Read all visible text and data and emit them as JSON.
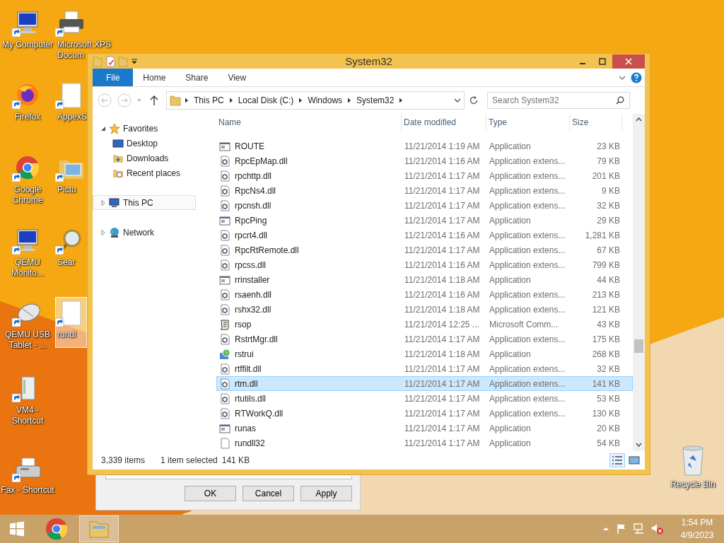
{
  "desktop": {
    "left_column": [
      {
        "label": "My Computer",
        "kind": "monitor",
        "selected": false
      },
      {
        "label": "Firefox",
        "kind": "firefox",
        "selected": false
      },
      {
        "label": "Google Chrome",
        "kind": "chrome",
        "selected": false
      },
      {
        "label": "QEMU Monito...",
        "kind": "monitor",
        "selected": false
      },
      {
        "label": "QEMU USB Tablet - ...",
        "kind": "mouse",
        "selected": false
      },
      {
        "label": "VM4 - Shortcut",
        "kind": "tower",
        "selected": false
      },
      {
        "label": "Fax - Shortcut",
        "kind": "fax",
        "selected": false
      }
    ],
    "second_column": [
      {
        "label_lines": [
          "Microsoft XPS",
          "Docum"
        ],
        "kind": "printer",
        "selected": false
      },
      {
        "label_lines": [
          "AppexS"
        ],
        "kind": "document",
        "selected": false
      },
      {
        "label_lines": [
          "Pictu"
        ],
        "kind": "folder",
        "selected": false
      },
      {
        "label_lines": [
          "Sear"
        ],
        "kind": "magnifier",
        "selected": false
      },
      {
        "label_lines": [
          "rundl"
        ],
        "kind": "document",
        "selected": true
      }
    ],
    "recycle_bin": {
      "label": "Recycle Bin"
    }
  },
  "back_dialog": {
    "buttons": [
      "OK",
      "Cancel",
      "Apply"
    ]
  },
  "window": {
    "title": "System32",
    "ribbon_tabs": [
      {
        "label": "File",
        "selected": true
      },
      {
        "label": "Home",
        "selected": false
      },
      {
        "label": "Share",
        "selected": false
      },
      {
        "label": "View",
        "selected": false
      }
    ],
    "breadcrumb": [
      "This PC",
      "Local Disk (C:)",
      "Windows",
      "System32"
    ],
    "search": {
      "placeholder": "Search System32"
    },
    "nav_tree": [
      {
        "label": "Favorites",
        "kind": "star",
        "expanded": true,
        "selected": false,
        "children": [
          {
            "label": "Desktop",
            "kind": "desktop",
            "selected": false
          },
          {
            "label": "Downloads",
            "kind": "downloads",
            "selected": false
          },
          {
            "label": "Recent places",
            "kind": "recent",
            "selected": false
          }
        ]
      },
      {
        "label": "This PC",
        "kind": "pc",
        "expanded": false,
        "selected": true
      },
      {
        "label": "Network",
        "kind": "network",
        "expanded": false,
        "selected": false
      }
    ],
    "table": {
      "columns": [
        "Name",
        "Date modified",
        "Type",
        "Size"
      ],
      "rows": [
        {
          "name": "ROUTE",
          "kind": "app",
          "date": "11/21/2014 1:19 AM",
          "type": "Application",
          "size": "23 KB",
          "selected": false
        },
        {
          "name": "RpcEpMap.dll",
          "kind": "dll",
          "date": "11/21/2014 1:16 AM",
          "type": "Application extens...",
          "size": "79 KB",
          "selected": false
        },
        {
          "name": "rpchttp.dll",
          "kind": "dll",
          "date": "11/21/2014 1:17 AM",
          "type": "Application extens...",
          "size": "201 KB",
          "selected": false
        },
        {
          "name": "RpcNs4.dll",
          "kind": "dll",
          "date": "11/21/2014 1:17 AM",
          "type": "Application extens...",
          "size": "9 KB",
          "selected": false
        },
        {
          "name": "rpcnsh.dll",
          "kind": "dll",
          "date": "11/21/2014 1:17 AM",
          "type": "Application extens...",
          "size": "32 KB",
          "selected": false
        },
        {
          "name": "RpcPing",
          "kind": "app",
          "date": "11/21/2014 1:17 AM",
          "type": "Application",
          "size": "29 KB",
          "selected": false
        },
        {
          "name": "rpcrt4.dll",
          "kind": "dll",
          "date": "11/21/2014 1:16 AM",
          "type": "Application extens...",
          "size": "1,281 KB",
          "selected": false
        },
        {
          "name": "RpcRtRemote.dll",
          "kind": "dll",
          "date": "11/21/2014 1:17 AM",
          "type": "Application extens...",
          "size": "67 KB",
          "selected": false
        },
        {
          "name": "rpcss.dll",
          "kind": "dll",
          "date": "11/21/2014 1:16 AM",
          "type": "Application extens...",
          "size": "799 KB",
          "selected": false
        },
        {
          "name": "rrinstaller",
          "kind": "app",
          "date": "11/21/2014 1:18 AM",
          "type": "Application",
          "size": "44 KB",
          "selected": false
        },
        {
          "name": "rsaenh.dll",
          "kind": "dll",
          "date": "11/21/2014 1:16 AM",
          "type": "Application extens...",
          "size": "213 KB",
          "selected": false
        },
        {
          "name": "rshx32.dll",
          "kind": "dll",
          "date": "11/21/2014 1:18 AM",
          "type": "Application extens...",
          "size": "121 KB",
          "selected": false
        },
        {
          "name": "rsop",
          "kind": "script",
          "date": "11/21/2014 12:25 ...",
          "type": "Microsoft Comm...",
          "size": "43 KB",
          "selected": false
        },
        {
          "name": "RstrtMgr.dll",
          "kind": "dll",
          "date": "11/21/2014 1:17 AM",
          "type": "Application extens...",
          "size": "175 KB",
          "selected": false
        },
        {
          "name": "rstrui",
          "kind": "restore",
          "date": "11/21/2014 1:18 AM",
          "type": "Application",
          "size": "268 KB",
          "selected": false
        },
        {
          "name": "rtffilt.dll",
          "kind": "dll",
          "date": "11/21/2014 1:17 AM",
          "type": "Application extens...",
          "size": "32 KB",
          "selected": false
        },
        {
          "name": "rtm.dll",
          "kind": "dll",
          "date": "11/21/2014 1:17 AM",
          "type": "Application extens...",
          "size": "141 KB",
          "selected": true
        },
        {
          "name": "rtutils.dll",
          "kind": "dll",
          "date": "11/21/2014 1:17 AM",
          "type": "Application extens...",
          "size": "53 KB",
          "selected": false
        },
        {
          "name": "RTWorkQ.dll",
          "kind": "dll",
          "date": "11/21/2014 1:17 AM",
          "type": "Application extens...",
          "size": "130 KB",
          "selected": false
        },
        {
          "name": "runas",
          "kind": "app",
          "date": "11/21/2014 1:17 AM",
          "type": "Application",
          "size": "20 KB",
          "selected": false
        },
        {
          "name": "rundll32",
          "kind": "blank",
          "date": "11/21/2014 1:17 AM",
          "type": "Application",
          "size": "54 KB",
          "selected": false
        }
      ]
    },
    "status_bar": {
      "item_count": "3,339 items",
      "selection": "1 item selected",
      "selection_size": "141 KB"
    },
    "view_buttons": [
      {
        "kind": "details",
        "selected": true
      },
      {
        "kind": "large-icons",
        "selected": false
      }
    ]
  },
  "taskbar": {
    "apps": [
      {
        "kind": "chrome",
        "selected": false
      },
      {
        "kind": "explorer",
        "selected": true
      }
    ],
    "clock": {
      "time": "1:54 PM",
      "date": "4/9/2023"
    }
  }
}
